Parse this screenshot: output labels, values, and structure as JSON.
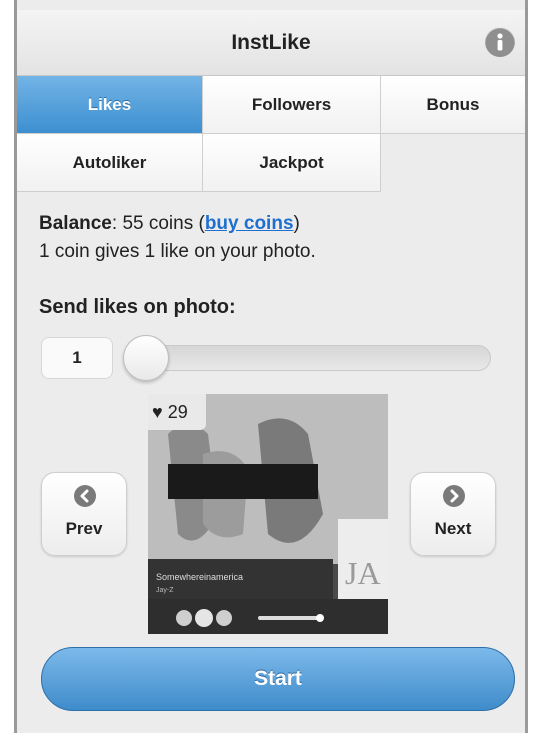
{
  "header": {
    "title": "InstLike"
  },
  "icons": {
    "info": "info-icon",
    "prev": "chevron-left-icon",
    "next": "chevron-right-icon",
    "heart": "heart-icon"
  },
  "tabs": [
    {
      "label": "Likes",
      "active": true
    },
    {
      "label": "Followers",
      "active": false
    },
    {
      "label": "Bonus",
      "active": false
    },
    {
      "label": "Autoliker",
      "active": false
    },
    {
      "label": "Jackpot",
      "active": false
    }
  ],
  "balance": {
    "label": "Balance",
    "sep": ": ",
    "amount_text": "55 coins",
    "open_paren": " (",
    "link": "buy coins",
    "close_paren": ")",
    "rate_text": "1 coin gives 1 like on your photo."
  },
  "send": {
    "label": "Send likes on photo:",
    "count": "1",
    "slider_fraction": 0.0
  },
  "photo": {
    "likes": "♥ 29",
    "overlay_text": "JAY-Z",
    "track_title": "Somewhereinamerica",
    "track_artist": "Jay-Z",
    "side_letters": "JA"
  },
  "nav": {
    "prev_label": "Prev",
    "next_label": "Next"
  },
  "start_label": "Start",
  "colors": {
    "accent": "#4a9ad8",
    "link": "#1f6fd0"
  }
}
